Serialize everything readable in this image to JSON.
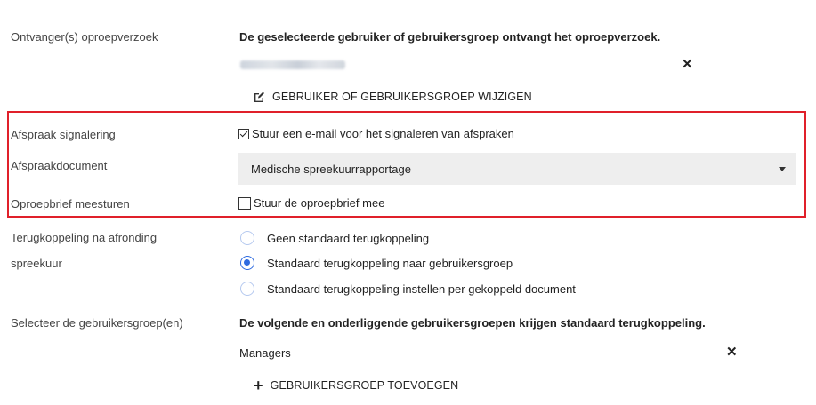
{
  "recipients": {
    "label": "Ontvanger(s) oproepverzoek",
    "description": "De geselecteerde gebruiker of gebruikersgroep ontvangt het oproepverzoek.",
    "remove_symbol": "✕",
    "change_link": "GEBRUIKER OF GEBRUIKERSGROEP WIJZIGEN"
  },
  "appointment_signal": {
    "label": "Afspraak signalering",
    "checkbox_label": "Stuur een e-mail voor het signaleren van afspraken",
    "checked": true
  },
  "appointment_document": {
    "label": "Afspraakdocument",
    "selected": "Medische spreekuurrapportage"
  },
  "invitation_letter": {
    "label": "Oproepbrief meesturen",
    "checkbox_label": "Stuur de oproepbrief mee",
    "checked": false
  },
  "feedback": {
    "label_line1": "Terugkoppeling na afronding",
    "label_line2": "spreekuur",
    "options": [
      {
        "label": "Geen standaard terugkoppeling",
        "selected": false
      },
      {
        "label": "Standaard terugkoppeling naar gebruikersgroep",
        "selected": true
      },
      {
        "label": "Standaard terugkoppeling instellen per gekoppeld document",
        "selected": false
      }
    ]
  },
  "user_groups": {
    "label": "Selecteer de gebruikersgroep(en)",
    "description": "De volgende en onderliggende gebruikersgroepen krijgen standaard terugkoppeling.",
    "items": [
      {
        "name": "Managers",
        "remove_symbol": "✕"
      }
    ],
    "add_symbol": "+",
    "add_link": "GEBRUIKERSGROEP TOEVOEGEN"
  },
  "colors": {
    "highlight_border": "#e0202a",
    "radio_accent": "#2f6be0",
    "select_background": "#eeeeee"
  }
}
